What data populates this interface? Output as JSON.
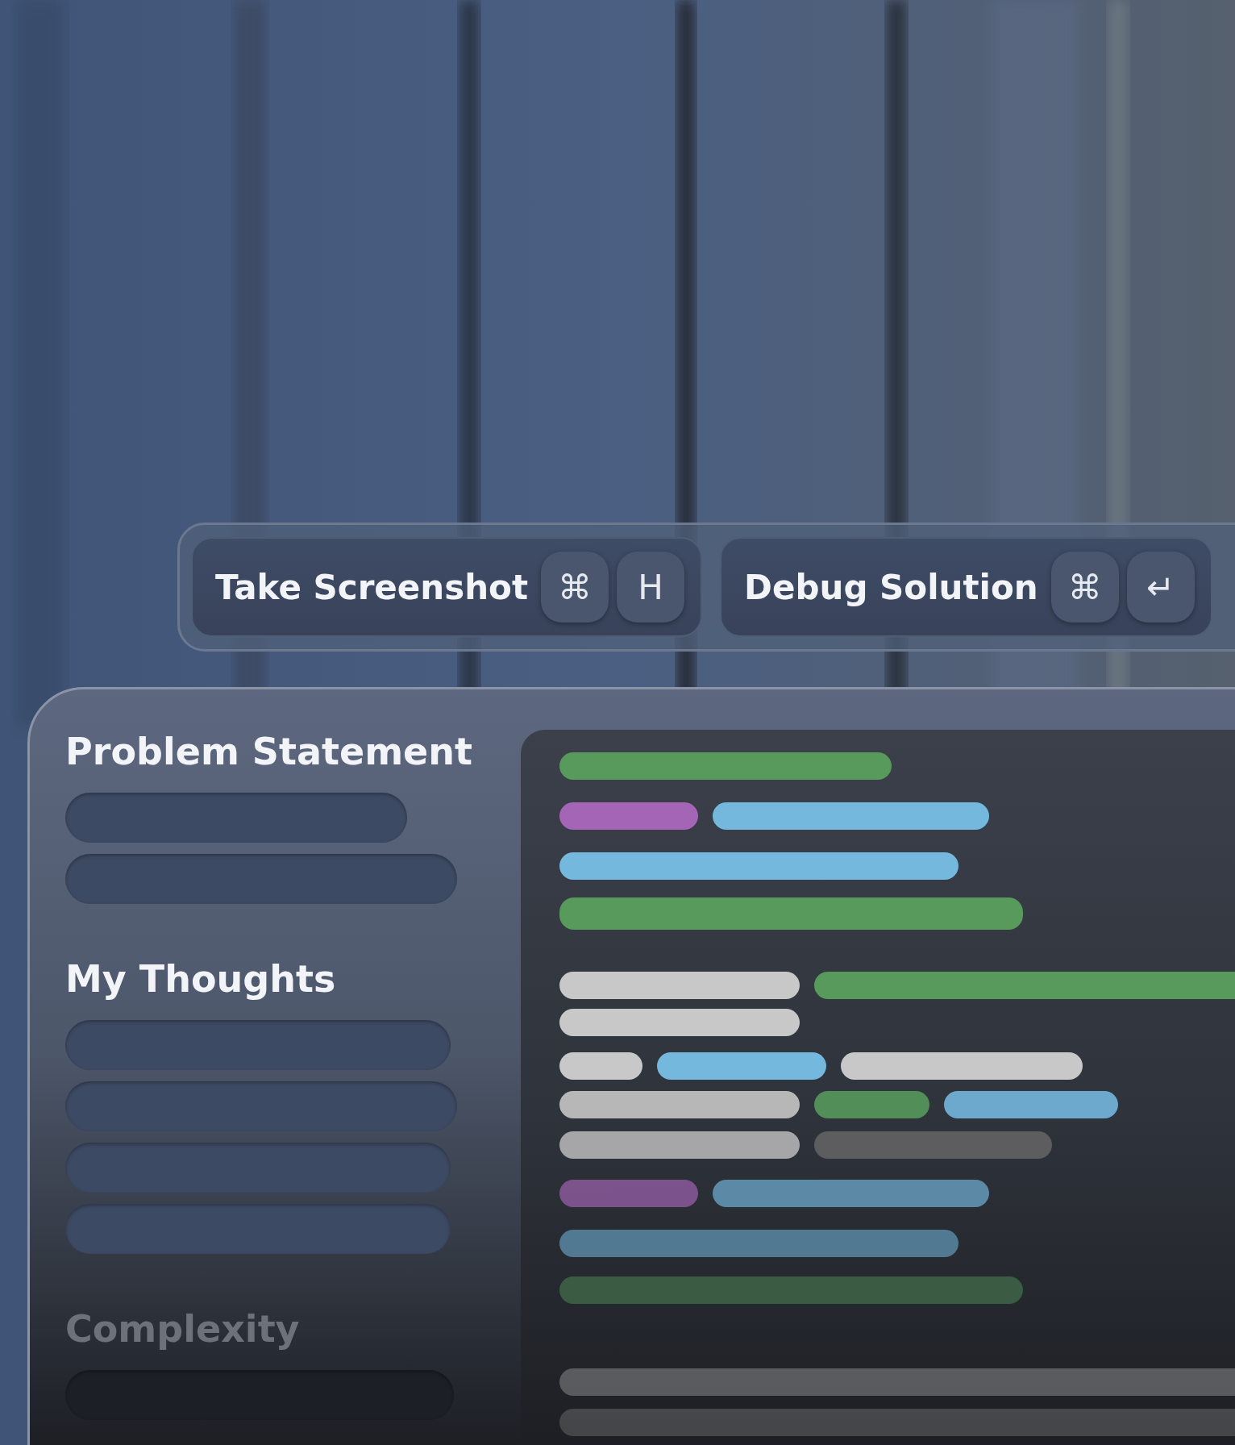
{
  "toolbar": {
    "buttons": [
      {
        "label": "Take Screenshot",
        "keys": [
          "⌘",
          "H"
        ]
      },
      {
        "label": "Debug Solution",
        "keys": [
          "⌘",
          "↵"
        ]
      }
    ]
  },
  "panel": {
    "sections": [
      {
        "heading": "Problem Statement"
      },
      {
        "heading": "My Thoughts"
      },
      {
        "heading": "Complexity"
      }
    ]
  }
}
